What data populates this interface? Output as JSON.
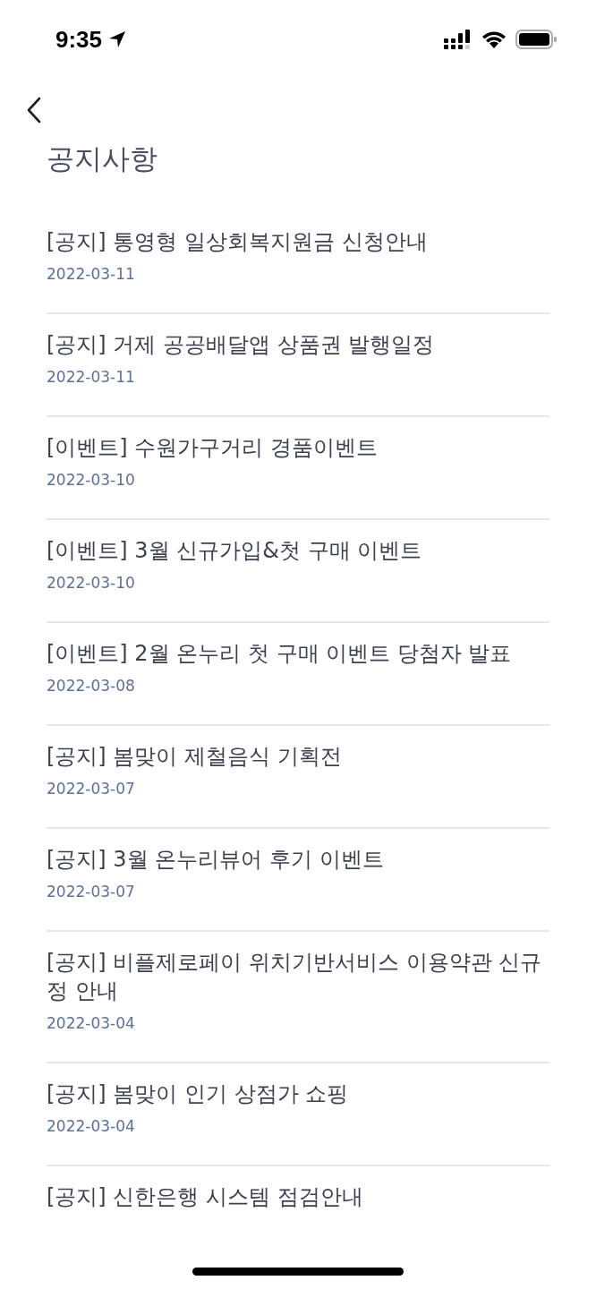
{
  "status_bar": {
    "time": "9:35"
  },
  "header": {
    "title": "공지사항"
  },
  "notices": [
    {
      "title": "[공지] 통영형 일상회복지원금 신청안내",
      "date": "2022-03-11"
    },
    {
      "title": "[공지] 거제 공공배달앱 상품권 발행일정",
      "date": "2022-03-11"
    },
    {
      "title": "[이벤트] 수원가구거리 경품이벤트",
      "date": "2022-03-10"
    },
    {
      "title": "[이벤트] 3월 신규가입&첫 구매 이벤트",
      "date": "2022-03-10"
    },
    {
      "title": "[이벤트] 2월 온누리 첫 구매 이벤트 당첨자 발표",
      "date": "2022-03-08"
    },
    {
      "title": "[공지] 봄맞이 제철음식 기획전",
      "date": "2022-03-07"
    },
    {
      "title": "[공지] 3월 온누리뷰어 후기 이벤트",
      "date": "2022-03-07"
    },
    {
      "title": "[공지] 비플제로페이 위치기반서비스 이용약관 신규 정 안내",
      "date": "2022-03-04"
    },
    {
      "title": "[공지] 봄맞이 인기 상점가 쇼핑",
      "date": "2022-03-04"
    },
    {
      "title": "[공지] 신한은행 시스템 점검안내"
    }
  ]
}
